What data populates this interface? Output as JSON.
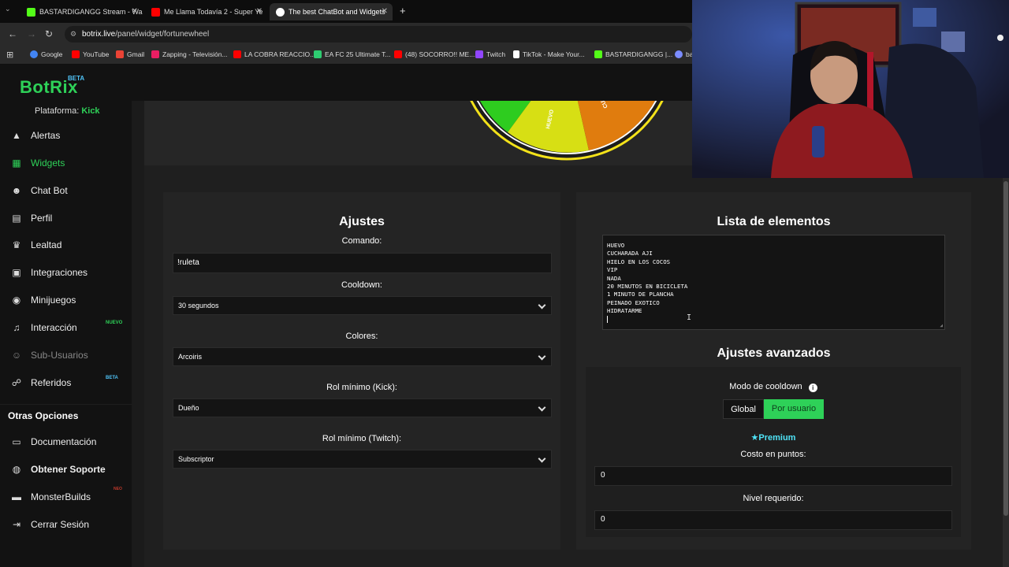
{
  "browser": {
    "tabs": [
      {
        "title": "BASTARDIGANGG Stream - Wa",
        "icon_color": "#53fc18"
      },
      {
        "title": "Me Llama Todavía 2 - Super Ye",
        "icon_color": "#ff0000"
      },
      {
        "title": "The best ChatBot and Widgets",
        "icon_color": "#ffffff"
      }
    ],
    "new_tab": "+",
    "url_host": "botrix.live",
    "url_path": "/panel/widget/fortunewheel",
    "bookmarks": [
      {
        "label": "Google",
        "icon_color": "#4285f4"
      },
      {
        "label": "YouTube",
        "icon_color": "#ff0000"
      },
      {
        "label": "Gmail",
        "icon_color": "#ea4335"
      },
      {
        "label": "Zapping - Televisión...",
        "icon_color": "#e91e63"
      },
      {
        "label": "LA COBRA REACCIO...",
        "icon_color": "#ff0000"
      },
      {
        "label": "EA FC 25 Ultimate T...",
        "icon_color": "#2ecc71"
      },
      {
        "label": "(48) SOCORRO!! ME...",
        "icon_color": "#ff0000"
      },
      {
        "label": "Twitch",
        "icon_color": "#9146ff"
      },
      {
        "label": "TikTok - Make Your...",
        "icon_color": "#ffffff"
      },
      {
        "label": "BASTARDIGANGG |...",
        "icon_color": "#53fc18"
      },
      {
        "label": "ba",
        "icon_color": "#7b8cff"
      }
    ]
  },
  "app": {
    "logo": "BotRix",
    "logo_badge": "BETA",
    "platform_label": "Plataforma:",
    "platform_value": "Kick",
    "accent": "#2ed158"
  },
  "sidebar": {
    "items": [
      {
        "label": "Alertas",
        "icon": "warning-icon",
        "glyph": "▲"
      },
      {
        "label": "Widgets",
        "icon": "widgets-icon",
        "glyph": "▦"
      },
      {
        "label": "Chat Bot",
        "icon": "robot-icon",
        "glyph": "☻"
      },
      {
        "label": "Perfil",
        "icon": "profile-card-icon",
        "glyph": "▤"
      },
      {
        "label": "Lealtad",
        "icon": "trophy-icon",
        "glyph": "♛"
      },
      {
        "label": "Integraciones",
        "icon": "integrations-icon",
        "glyph": "▣"
      },
      {
        "label": "Minijuegos",
        "icon": "gamepad-icon",
        "glyph": "◉"
      },
      {
        "label": "Interacción",
        "icon": "music-icon",
        "glyph": "♫",
        "badge": "NUEVO"
      },
      {
        "label": "Sub-Usuarios",
        "icon": "users-icon",
        "glyph": "☺"
      },
      {
        "label": "Referidos",
        "icon": "share-icon",
        "glyph": "☍",
        "badge": "BETA"
      }
    ],
    "section_title": "Otras Opciones",
    "other_items": [
      {
        "label": "Documentación",
        "icon": "book-icon",
        "glyph": "▭"
      },
      {
        "label": "Obtener Soporte",
        "icon": "support-icon",
        "glyph": "◍"
      },
      {
        "label": "MonsterBuilds",
        "icon": "laptop-icon",
        "glyph": "▬",
        "badge": "NEO"
      },
      {
        "label": "Cerrar Sesión",
        "icon": "logout-icon",
        "glyph": "⇥"
      }
    ]
  },
  "wheel": {
    "segment_labels": [
      "HUEVO",
      "CUCHARADA AJI"
    ]
  },
  "settings": {
    "title": "Ajustes",
    "command_label": "Comando:",
    "command_value": "!ruleta",
    "cooldown_label": "Cooldown:",
    "cooldown_value": "30 segundos",
    "colors_label": "Colores:",
    "colors_value": "Arcoiris",
    "role_kick_label": "Rol mínimo (Kick):",
    "role_kick_value": "Dueño",
    "role_twitch_label": "Rol mínimo (Twitch):",
    "role_twitch_value": "Subscriptor"
  },
  "elements": {
    "title": "Lista de elementos",
    "items": [
      "HUEVO",
      "CUCHARADA AJI",
      "HIELO EN LOS COCOS",
      "VIP",
      "NADA",
      "20 MINUTOS EN BICICLETA",
      "1 MINUTO DE PLANCHA",
      "PEINADO EXOTICO",
      "HIDRATARME"
    ]
  },
  "advanced": {
    "title": "Ajustes avanzados",
    "cooldown_mode_label": "Modo de cooldown",
    "mode_global": "Global",
    "mode_per_user": "Por usuario",
    "premium_label": "Premium",
    "cost_label": "Costo en puntos:",
    "cost_value": "0",
    "level_label": "Nivel requerido:",
    "level_value": "0"
  }
}
